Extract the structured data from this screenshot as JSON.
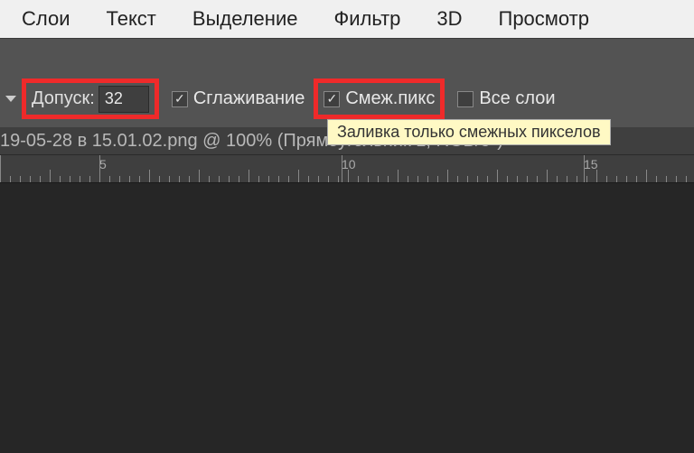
{
  "menubar": {
    "items": [
      "Слои",
      "Текст",
      "Выделение",
      "Фильтр",
      "3D",
      "Просмотр"
    ]
  },
  "options": {
    "tolerance_label": "Допуск:",
    "tolerance_value": "32",
    "antialias_label": "Сглаживание",
    "antialias_checked": true,
    "contiguous_label": "Смеж.пикс",
    "contiguous_checked": true,
    "all_layers_label": "Все слои",
    "all_layers_checked": false
  },
  "tooltip": "Заливка только смежных пикселов",
  "document_title": "19-05-28 в 15.01.02.png @ 100% (Прямоугольник 1, RGB/8*) *",
  "ruler": {
    "marks": [
      "5",
      "10",
      "15"
    ]
  }
}
